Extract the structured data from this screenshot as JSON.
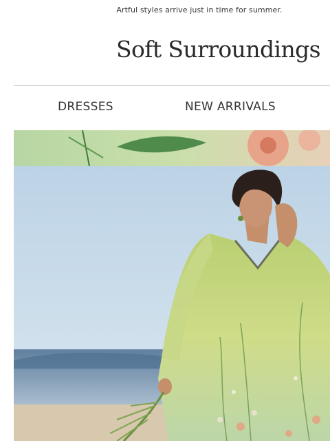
{
  "preheader": {
    "text": "Artful styles arrive just in time for summer."
  },
  "brand": {
    "logo_text": "Soft Surroundings"
  },
  "nav": {
    "items": [
      {
        "label": "DRESSES"
      },
      {
        "label": "NEW ARRIVALS"
      }
    ]
  },
  "hero": {
    "image_subject": "woman in green floral caftan on beach",
    "colors": {
      "sky": "#c9dcea",
      "sea": "#6f8fae",
      "sand": "#d9c7ab",
      "caftan": "#c9d77a",
      "banner": "#a9cf9b"
    }
  }
}
